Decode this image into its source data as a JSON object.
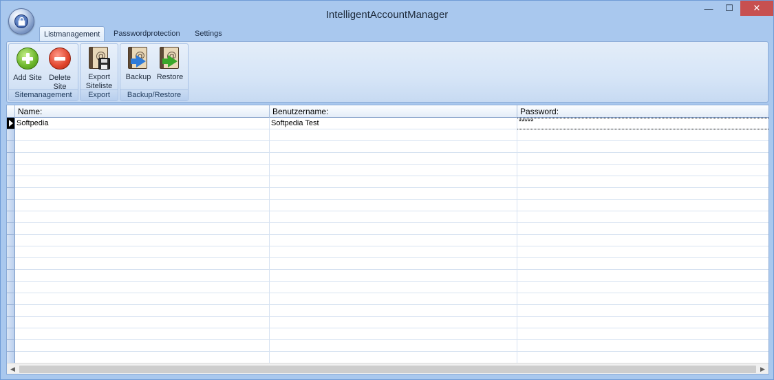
{
  "window": {
    "title": "IntelligentAccountManager",
    "minimize_glyph": "—",
    "maximize_glyph": "☐",
    "close_glyph": "✕"
  },
  "tabs": [
    {
      "label": "Listmanagement",
      "active": true
    },
    {
      "label": "Passwordprotection",
      "active": false
    },
    {
      "label": "Settings",
      "active": false
    }
  ],
  "ribbon": {
    "groups": [
      {
        "label": "Sitemanagement",
        "buttons": [
          {
            "label": "Add Site",
            "icon": "add-icon"
          },
          {
            "label": "Delete Site",
            "icon": "delete-icon"
          }
        ]
      },
      {
        "label": "Export",
        "buttons": [
          {
            "label": "Export Siteliste",
            "icon": "export-save-icon"
          }
        ]
      },
      {
        "label": "Backup/Restore",
        "buttons": [
          {
            "label": "Backup",
            "icon": "backup-icon"
          },
          {
            "label": "Restore",
            "icon": "restore-icon"
          }
        ]
      }
    ]
  },
  "grid": {
    "columns": [
      "Name:",
      "Benutzername:",
      "Password:"
    ],
    "rows": [
      {
        "name": "Softpedia",
        "username": "Softpedia Test",
        "password": "*****"
      }
    ]
  },
  "colors": {
    "window_frame": "#a9c8ee",
    "ribbon_bg": "#d6e5f7",
    "close_button": "#c75050"
  }
}
